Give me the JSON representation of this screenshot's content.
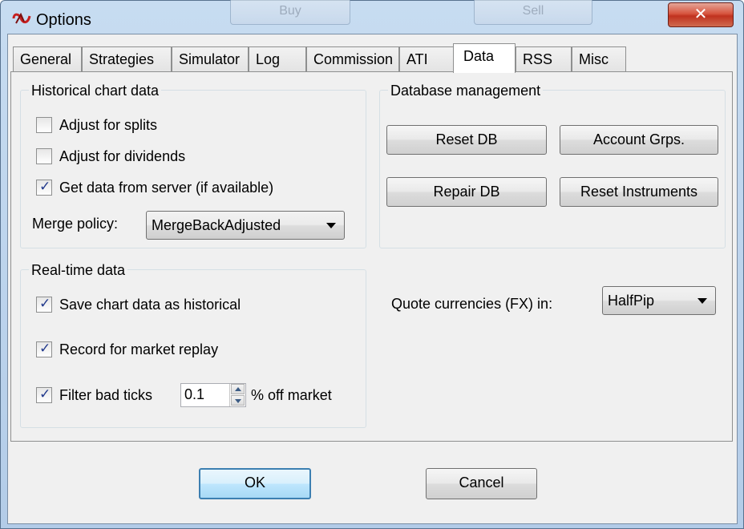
{
  "window": {
    "title": "Options",
    "close_glyph": "✕",
    "behind_buttons": [
      "Buy",
      "Sell"
    ]
  },
  "tabs": [
    "General",
    "Strategies",
    "Simulator",
    "Log",
    "Commission",
    "ATI",
    "Data",
    "RSS",
    "Misc"
  ],
  "active_tab": "Data",
  "historical": {
    "title": "Historical chart data",
    "adjust_splits": {
      "label": "Adjust for splits",
      "checked": false
    },
    "adjust_dividends": {
      "label": "Adjust for dividends",
      "checked": false
    },
    "get_from_server": {
      "label": "Get data from server (if available)",
      "checked": true
    },
    "merge_policy_label": "Merge policy:",
    "merge_policy_value": "MergeBackAdjusted"
  },
  "database": {
    "title": "Database management",
    "reset_db": "Reset DB",
    "account_grps": "Account Grps.",
    "repair_db": "Repair DB",
    "reset_instruments": "Reset Instruments"
  },
  "realtime": {
    "title": "Real-time data",
    "save_chart": {
      "label": "Save chart data as historical",
      "checked": true
    },
    "record_replay": {
      "label": "Record for market replay",
      "checked": true
    },
    "filter_bad": {
      "label": "Filter bad ticks",
      "checked": true
    },
    "filter_value": "0.1",
    "filter_suffix": "% off market"
  },
  "quote": {
    "label": "Quote currencies (FX) in:",
    "value": "HalfPip"
  },
  "footer": {
    "ok": "OK",
    "cancel": "Cancel"
  },
  "colors": {
    "check": "#21398c",
    "default_border": "#3c7fb1",
    "close": "#c0321f"
  }
}
